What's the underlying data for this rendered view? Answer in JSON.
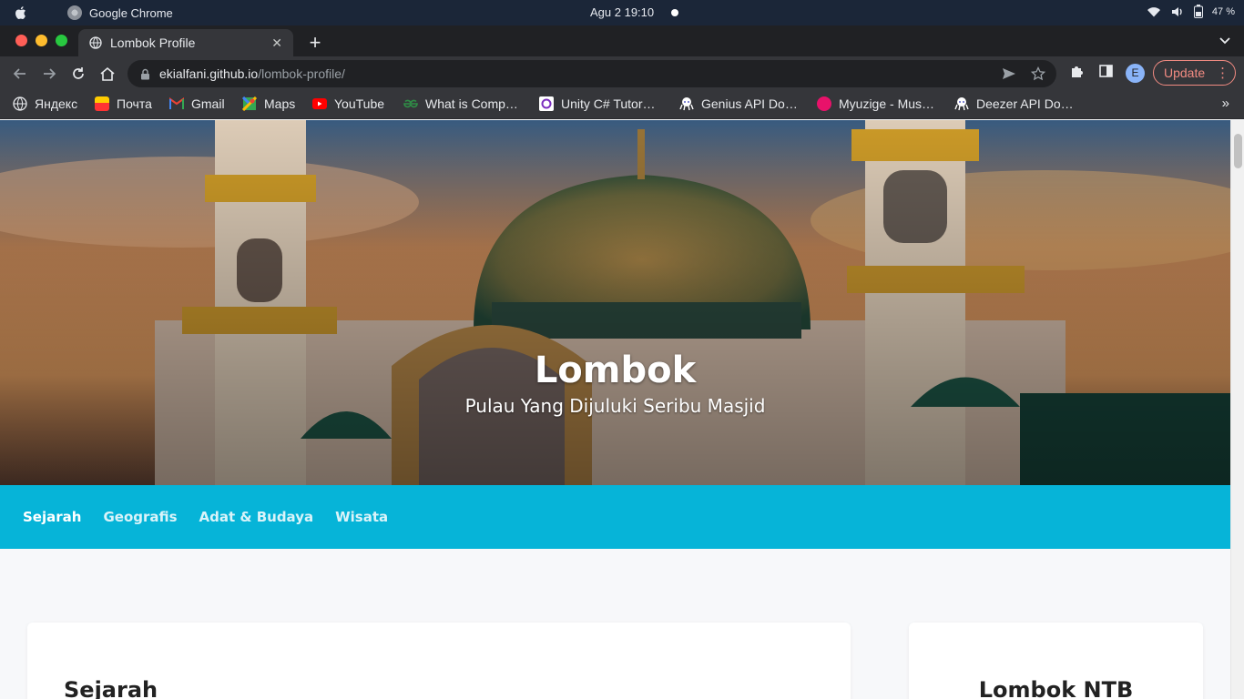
{
  "os": {
    "app_name": "Google Chrome",
    "clock": "Agu 2  19:10",
    "battery": "47 %"
  },
  "browser": {
    "tab_title": "Lombok Profile",
    "url_host": "ekialfani.github.io",
    "url_path": "/lombok-profile/",
    "profile_initial": "E",
    "update_label": "Update"
  },
  "bookmarks": [
    {
      "label": "Яндекс",
      "icon": "globe-icon"
    },
    {
      "label": "Почта",
      "icon": "mail-icon"
    },
    {
      "label": "Gmail",
      "icon": "gmail-icon"
    },
    {
      "label": "Maps",
      "icon": "maps-icon"
    },
    {
      "label": "YouTube",
      "icon": "youtube-icon"
    },
    {
      "label": "What is Comp…",
      "icon": "gfg-icon"
    },
    {
      "label": "Unity C# Tutor…",
      "icon": "unity-icon"
    },
    {
      "label": "Genius API Do…",
      "icon": "octo-icon"
    },
    {
      "label": "Myuzige - Mus…",
      "icon": "music-icon"
    },
    {
      "label": "Deezer API Do…",
      "icon": "octo-icon"
    }
  ],
  "hero": {
    "title": "Lombok",
    "subtitle": "Pulau Yang Dijuluki Seribu Masjid"
  },
  "nav": [
    "Sejarah",
    "Geografis",
    "Adat & Budaya",
    "Wisata"
  ],
  "main": {
    "section_title": "Sejarah",
    "aside_title": "Lombok NTB"
  },
  "colors": {
    "nav_bg": "#06b4d8",
    "update_accent": "#f28b82"
  }
}
